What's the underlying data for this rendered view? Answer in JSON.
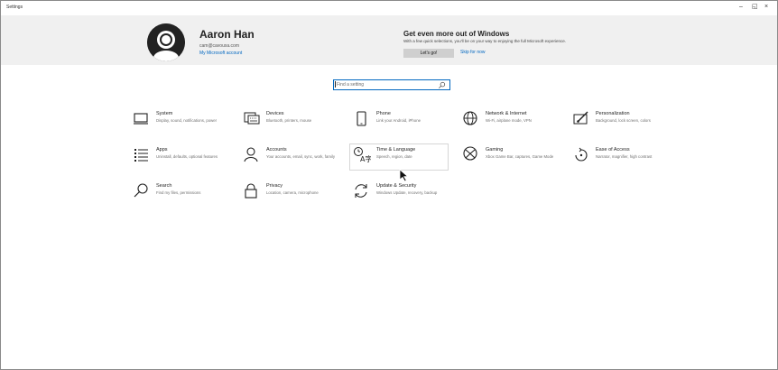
{
  "window": {
    "title": "Settings",
    "minimize": "–",
    "maximize": "◱",
    "close": "×"
  },
  "account": {
    "name": "Aaron Han",
    "email": "cam@cavouxa.com",
    "link": "My Microsoft account"
  },
  "promo": {
    "title": "Get even more out of Windows",
    "text": "With a few quick selections, you'll be on your way to enjoying the full Microsoft experience.",
    "button": "Let's go!",
    "skip": "Skip for now"
  },
  "search": {
    "placeholder": "Find a setting",
    "icon": "search-icon"
  },
  "tiles": [
    {
      "title": "System",
      "desc": "Display, sound, notifications, power",
      "icon": "monitor-icon"
    },
    {
      "title": "Devices",
      "desc": "Bluetooth, printers, mouse",
      "icon": "keyboard-icon"
    },
    {
      "title": "Phone",
      "desc": "Link your Android, iPhone",
      "icon": "phone-icon"
    },
    {
      "title": "Network & Internet",
      "desc": "Wi-Fi, airplane mode, VPN",
      "icon": "globe-icon"
    },
    {
      "title": "Personalization",
      "desc": "Background, lock screen, colors",
      "icon": "paintbrush-icon"
    },
    {
      "title": "Apps",
      "desc": "Uninstall, defaults, optional features",
      "icon": "apps-list-icon"
    },
    {
      "title": "Accounts",
      "desc": "Your accounts, email, sync, work, family",
      "icon": "person-icon"
    },
    {
      "title": "Time & Language",
      "desc": "Speech, region, date",
      "icon": "time-language-icon"
    },
    {
      "title": "Gaming",
      "desc": "Xbox Game Bar, captures, Game Mode",
      "icon": "xbox-icon"
    },
    {
      "title": "Ease of Access",
      "desc": "Narrator, magnifier, high contrast",
      "icon": "ease-of-access-icon"
    },
    {
      "title": "Search",
      "desc": "Find my files, permissions",
      "icon": "search-icon"
    },
    {
      "title": "Privacy",
      "desc": "Location, camera, microphone",
      "icon": "lock-icon"
    },
    {
      "title": "Update & Security",
      "desc": "Windows Update, recovery, backup",
      "icon": "sync-icon"
    }
  ]
}
